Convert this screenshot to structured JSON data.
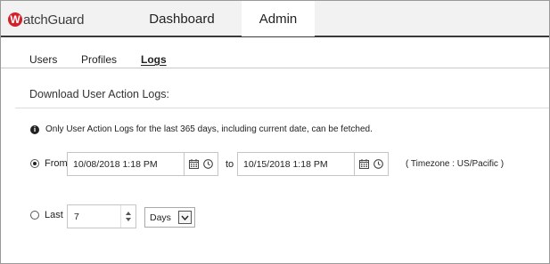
{
  "header": {
    "logo_text": "WatchGuard",
    "nav": [
      {
        "label": "Dashboard",
        "active": false
      },
      {
        "label": "Admin",
        "active": true
      }
    ]
  },
  "subnav": {
    "tabs": [
      {
        "label": "Users",
        "active": false
      },
      {
        "label": "Profiles",
        "active": false
      },
      {
        "label": "Logs",
        "active": true
      }
    ]
  },
  "logs": {
    "title": "Download User Action Logs:",
    "info_text": "Only User Action Logs for the last 365 days, including current date, can be fetched.",
    "from": {
      "label": "From",
      "selected": true,
      "start_value": "10/08/2018 1:18 PM",
      "to_label": "to",
      "end_value": "10/15/2018 1:18 PM",
      "timezone": "( Timezone : US/Pacific )"
    },
    "last": {
      "label": "Last",
      "selected": false,
      "value": "7",
      "unit": "Days"
    }
  },
  "icons": {
    "info": "info-icon",
    "calendar": "calendar-icon",
    "clock": "clock-icon",
    "step_up": "chevron-up-icon",
    "step_down": "chevron-down-icon",
    "dropdown": "dropdown-arrow-icon"
  },
  "colors": {
    "brand_red": "#d3202a",
    "topbar_bg": "#f2f2f2",
    "topbar_border": "#3a3a3a"
  }
}
